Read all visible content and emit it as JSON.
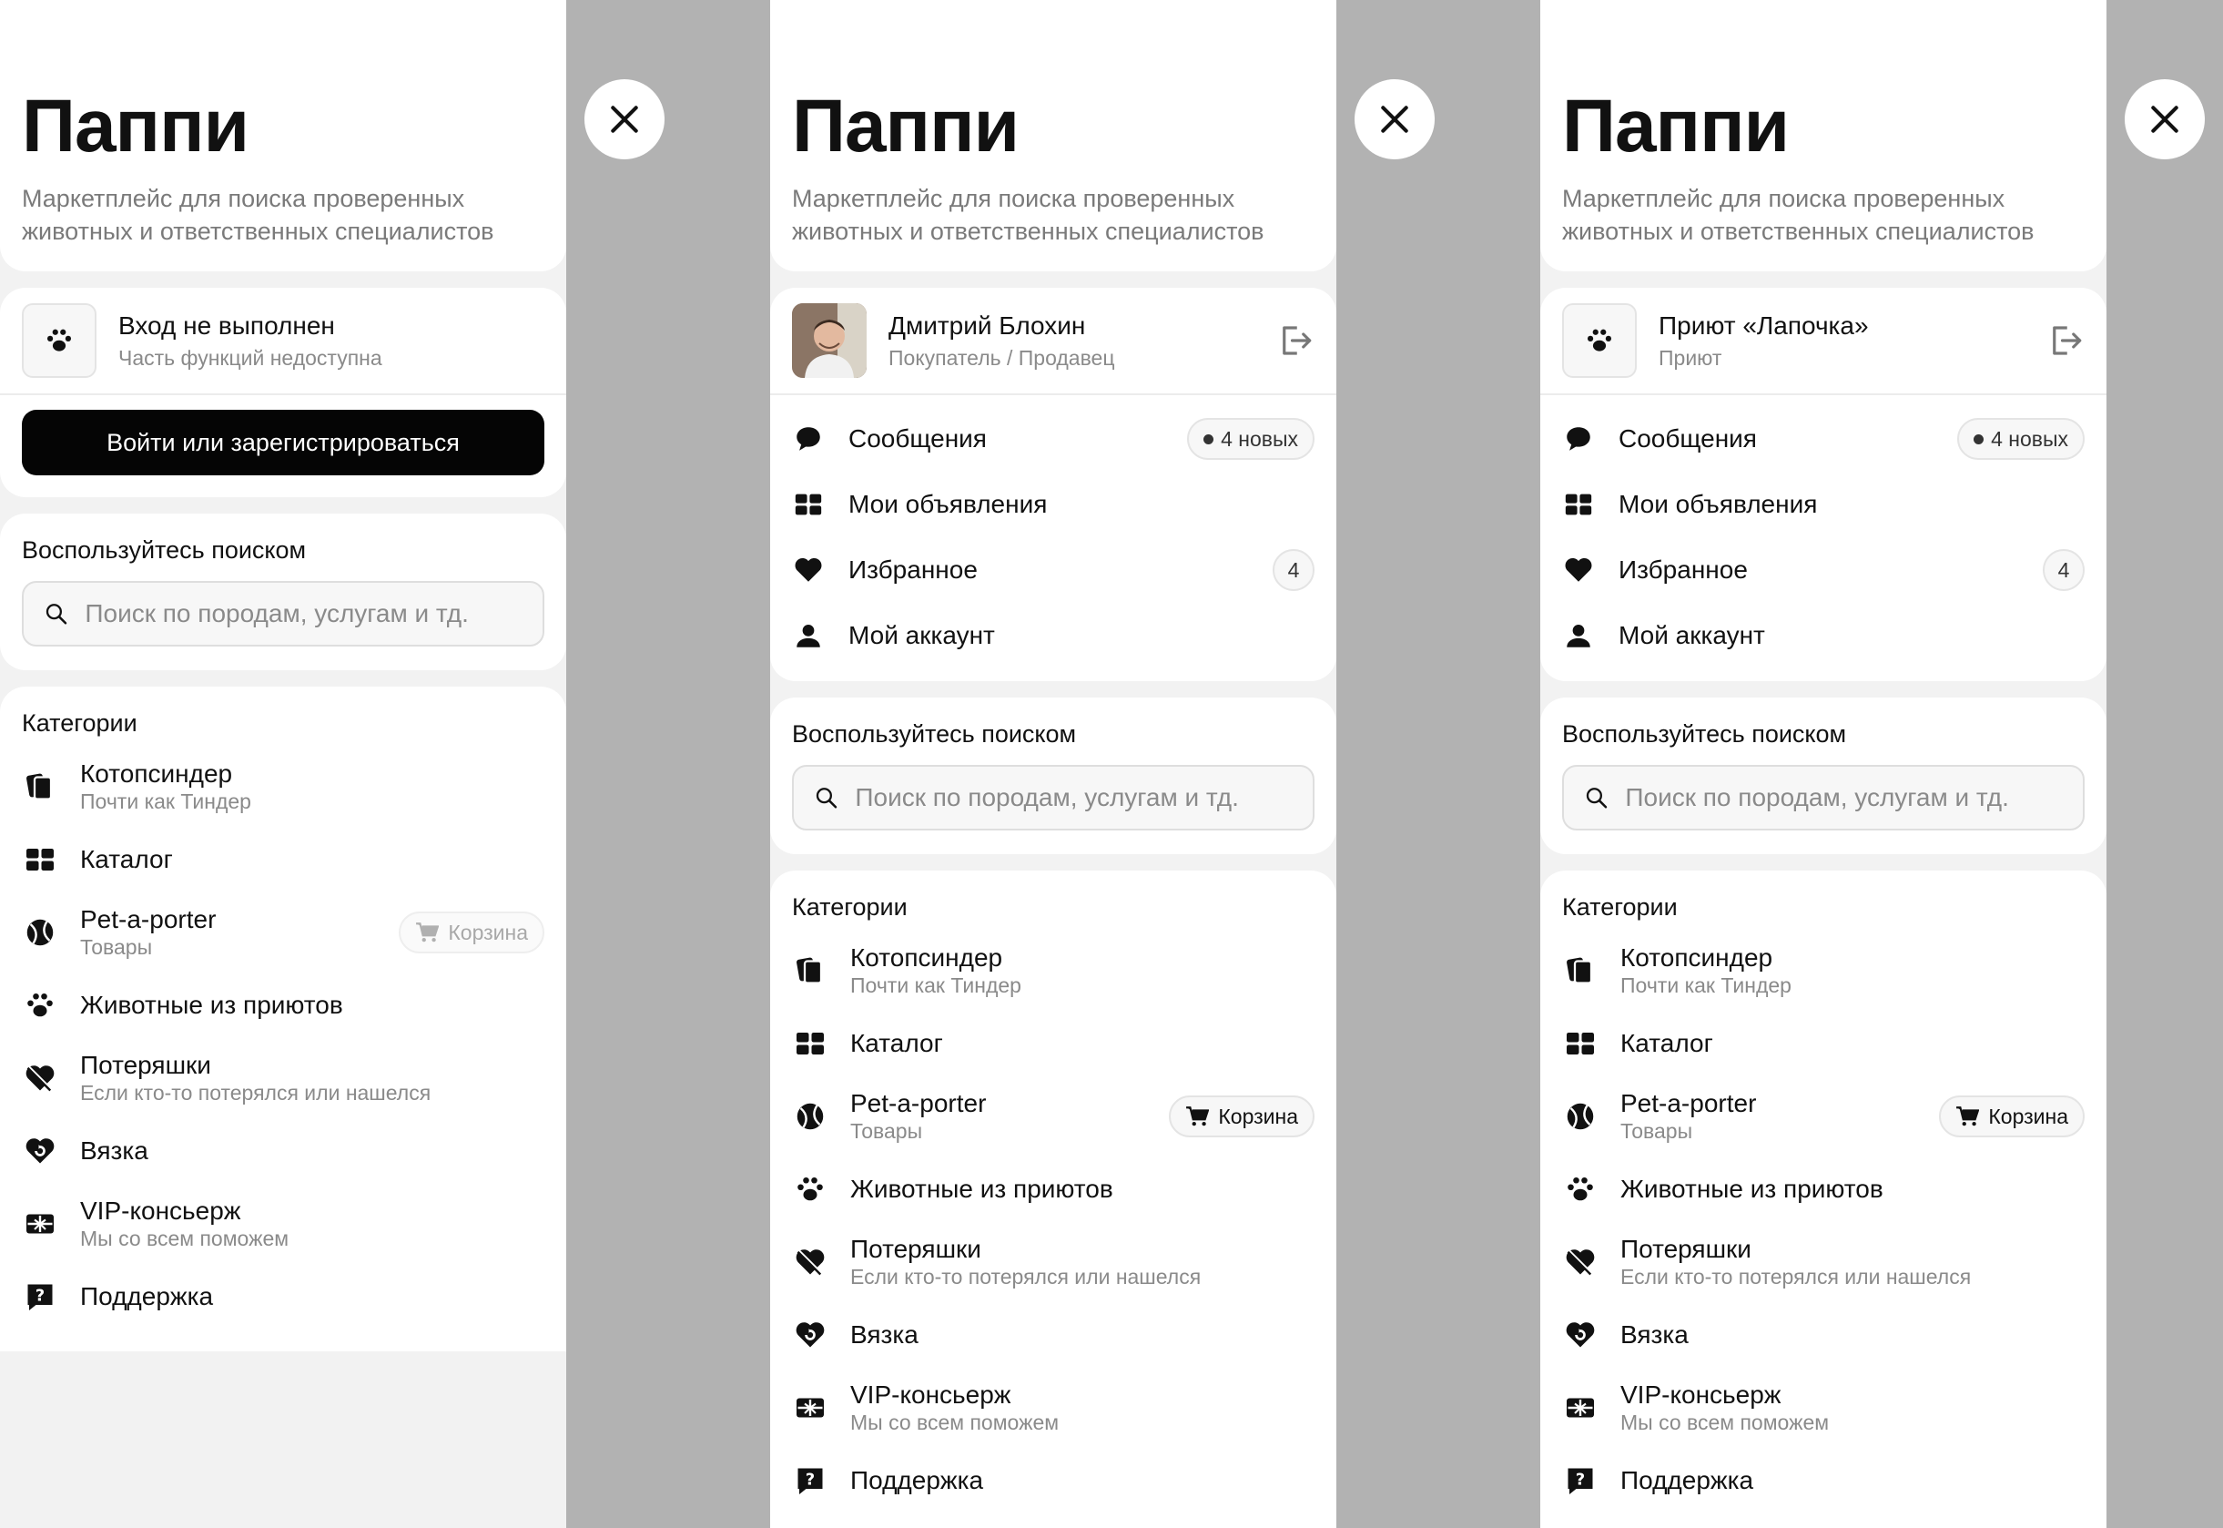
{
  "app": {
    "title": "Паппи",
    "subtitle": "Маркетплейс для поиска проверенных животных и ответственных специалистов"
  },
  "panels": [
    {
      "user": {
        "name": "Вход не выполнен",
        "role": "Часть функций недоступна",
        "avatar_icon": "paw-icon"
      },
      "login_button": "Войти или зарегистрироваться",
      "cart_disabled": true
    },
    {
      "user": {
        "name": "Дмитрий Блохин",
        "role": "Покупатель / Продавец",
        "avatar_icon": "user-photo"
      },
      "cart_disabled": false
    },
    {
      "user": {
        "name": "Приют «Лапочка»",
        "role": "Приют",
        "avatar_icon": "paw-icon"
      },
      "cart_disabled": false
    }
  ],
  "menu": {
    "messages": "Сообщения",
    "messages_badge": "4 новых",
    "my_ads": "Мои объявления",
    "favorites": "Избранное",
    "favorites_count": "4",
    "account": "Мой аккаунт"
  },
  "search": {
    "title": "Воспользуйтесь поиском",
    "placeholder": "Поиск по породам, услугам и тд."
  },
  "categories": {
    "title": "Категории",
    "items": [
      {
        "title": "Котопсиндер",
        "sub": "Почти как Тиндер",
        "icon": "cards-icon"
      },
      {
        "title": "Каталог",
        "sub": "",
        "icon": "grid-icon"
      },
      {
        "title": "Pet-a-porter",
        "sub": "Товары",
        "icon": "ball-icon",
        "cart": "Корзина"
      },
      {
        "title": "Животные из приютов",
        "sub": "",
        "icon": "paw-icon"
      },
      {
        "title": "Потеряшки",
        "sub": "Если кто-то потерялся или нашелся",
        "icon": "broken-heart-icon"
      },
      {
        "title": "Вязка",
        "sub": "",
        "icon": "heart-refresh-icon"
      },
      {
        "title": "VIP-консьерж",
        "sub": "Мы со всем поможем",
        "icon": "gift-card-icon"
      },
      {
        "title": "Поддержка",
        "sub": "",
        "icon": "help-bubble-icon"
      }
    ]
  },
  "colors": {
    "backdrop": "#b2b2b2",
    "panel": "#f2f2f2",
    "card": "#ffffff",
    "primary": "#050505",
    "muted": "#8a8a8a"
  }
}
